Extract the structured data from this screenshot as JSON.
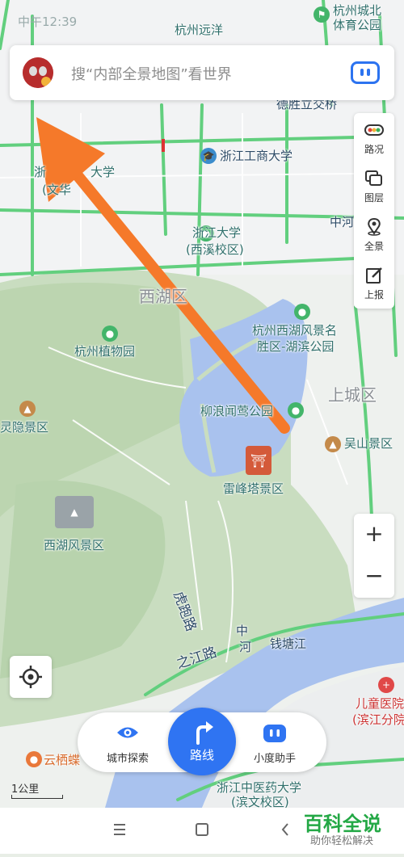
{
  "status_bar": {
    "time": "中午12:39"
  },
  "search": {
    "placeholder": "搜“内部全景地图”看世界"
  },
  "side_panel": {
    "items": [
      {
        "label": "路况",
        "icon": "traffic-light-icon"
      },
      {
        "label": "图层",
        "icon": "layers-icon"
      },
      {
        "label": "全景",
        "icon": "panorama-pin-icon"
      },
      {
        "label": "上报",
        "icon": "report-edit-icon"
      }
    ]
  },
  "zoom": {
    "in": "+",
    "out": "−"
  },
  "map_labels": {
    "hz_north_stadium_1": "杭州城北",
    "hz_north_stadium_2": "体育公园",
    "hz_yuanyang": "杭州远洋",
    "desheng_bridge": "德胜立交桥",
    "zj_business_univ": "浙江工商大学",
    "univ_1": "浙",
    "univ_2": "大学",
    "univ_3": "(文华",
    "zju_1": "浙江大学",
    "zju_2": "(西溪校区)",
    "zhonghe": "中河",
    "west_lake_district": "西湖区",
    "botanical_garden": "杭州植物园",
    "west_lake_park_1": "杭州西湖风景名",
    "west_lake_park_2": "胜区-湖滨公园",
    "shangcheng": "上城区",
    "lingyin": "灵隐景区",
    "liulang": "柳浪闻莺公园",
    "wushan": "吴山景区",
    "leifeng": "雷峰塔景区",
    "west_lake_scenic": "西湖风景区",
    "hupao_road": "虎跑路",
    "zhijiang_road": "之江路",
    "qiantang_river": "钱塘江",
    "river_he": "河",
    "river_zhong": "中",
    "childrens_hosp_1": "儿童医院",
    "childrens_hosp_2": "(滨江分院",
    "yunqi": "云栖蝶",
    "tcm_univ_1": "浙江中医药大学",
    "tcm_univ_2": "(滨文校区)"
  },
  "bottom_bar": {
    "city_explore": "城市探索",
    "route": "路线",
    "assistant": "小度助手"
  },
  "scale": {
    "label": "1公里"
  },
  "watermark": {
    "title": "百科全说",
    "subtitle": "助你轻松解决"
  },
  "colors": {
    "accent": "#2f74f2",
    "arrow": "#f5792a",
    "road": "#5fcf7a",
    "water": "#a9c2ee",
    "park": "#c7dcbc"
  }
}
